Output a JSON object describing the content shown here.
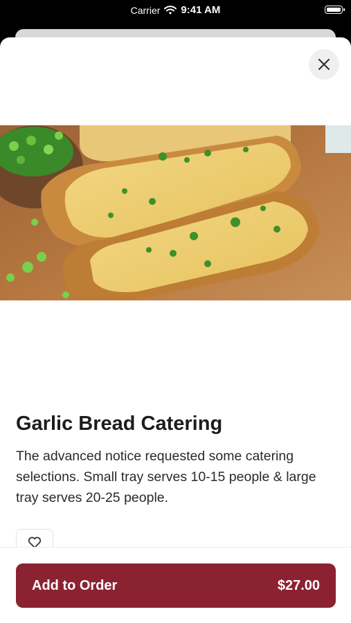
{
  "status_bar": {
    "carrier": "Carrier",
    "time": "9:41 AM"
  },
  "item": {
    "title": "Garlic Bread Catering",
    "description": "The advanced notice requested some catering selections. Small tray serves 10-15 people & large tray serves 20-25 people.",
    "image_alt": "Garlic bread with chopped green onions"
  },
  "actions": {
    "close_icon": "close-icon",
    "favorite_icon": "heart-outline-icon",
    "add_label": "Add to Order",
    "price": "$27.00"
  },
  "colors": {
    "accent": "#8b2232",
    "close_bg": "#f0f0f0"
  }
}
